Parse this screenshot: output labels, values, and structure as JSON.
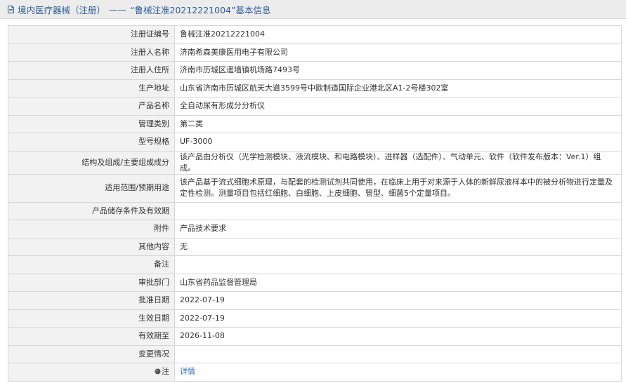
{
  "header": {
    "category": "境内医疗器械（注册）",
    "separator": "——",
    "subject": "“鲁械注准20212221004”基本信息"
  },
  "rows": [
    {
      "label": "注册证编号",
      "value": "鲁械注准20212221004"
    },
    {
      "label": "注册人名称",
      "value": "济南希森美康医用电子有限公司"
    },
    {
      "label": "注册人住所",
      "value": "济南市历城区遥墙镇机场路7493号"
    },
    {
      "label": "生产地址",
      "value": "山东省济南市历城区航天大道3599号中欧制造国际企业港北区A1-2号楼302室"
    },
    {
      "label": "产品名称",
      "value": "全自动尿有形成分分析仪"
    },
    {
      "label": "管理类别",
      "value": "第二类"
    },
    {
      "label": "型号规格",
      "value": "UF-3000"
    },
    {
      "label": "结构及组成/主要组成成分",
      "value": "该产品由分析仪（光学检测模块、液流模块、和电路模块）、进样器（选配件）、气动单元、软件（软件发布版本：Ver.1）组成。"
    },
    {
      "label": "适用范围/预期用途",
      "value": "该产品基于流式细胞术原理，与配套的检测试剂共同使用，在临床上用于对来源于人体的新鲜尿液样本中的被分析物进行定量及定性检测。测量项目包括红细胞、白细胞、上皮细胞、管型、细菌5个定量项目。"
    },
    {
      "label": "产品储存条件及有效期",
      "value": ""
    },
    {
      "label": "附件",
      "value": "产品技术要求"
    },
    {
      "label": "其他内容",
      "value": "无"
    },
    {
      "label": "备注",
      "value": ""
    },
    {
      "label": "审批部门",
      "value": "山东省药品监督管理局"
    },
    {
      "label": "批准日期",
      "value": "2022-07-19"
    },
    {
      "label": "生效日期",
      "value": "2022-07-19"
    },
    {
      "label": "有效期至",
      "value": "2026-11-08"
    },
    {
      "label": "变更情况",
      "value": ""
    }
  ],
  "note_row": {
    "label": "注",
    "link_text": "详情"
  },
  "colors": {
    "title_text": "#2d5c9a",
    "link": "#2f6fb8",
    "label_bg": "#f2f2f2",
    "header_bg": "#ececec"
  }
}
